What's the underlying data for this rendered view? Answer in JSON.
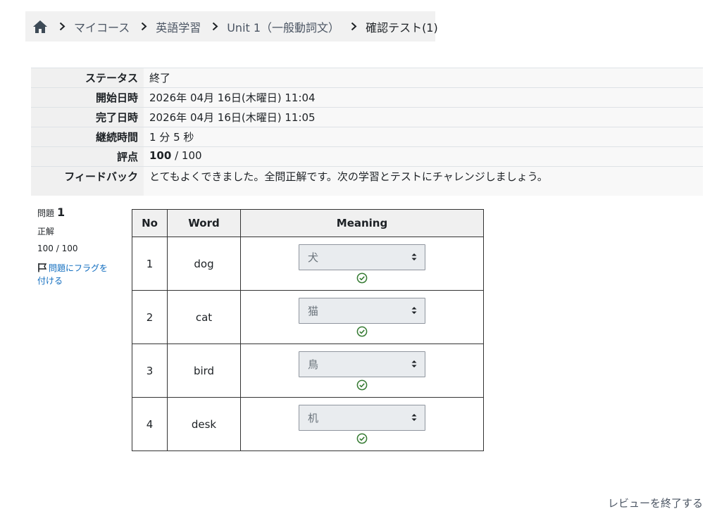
{
  "breadcrumb": {
    "items": [
      "マイコース",
      "英語学習",
      "Unit 1（一般動詞文）"
    ],
    "current": "確認テスト(1)"
  },
  "summary": {
    "status_label": "ステータス",
    "status_value": "終了",
    "started_label": "開始日時",
    "started_value": "2026年 04月 16日(木曜日) 11:04",
    "completed_label": "完了日時",
    "completed_value": "2026年 04月 16日(木曜日) 11:05",
    "duration_label": "継続時間",
    "duration_value": "1 分 5 秒",
    "grade_label": "評点",
    "grade_score": "100",
    "grade_max": " / 100",
    "feedback_label": "フィードバック",
    "feedback_value": "とてもよくできました。全問正解です。次の学習とテストにチャレンジしましょう。"
  },
  "question": {
    "label": "問題",
    "number": "1",
    "state": "正解",
    "grade": "100 / 100",
    "flag_label": "問題にフラグを付ける"
  },
  "word_table": {
    "headers": {
      "no": "No",
      "word": "Word",
      "meaning": "Meaning"
    },
    "rows": [
      {
        "no": "1",
        "word": "dog",
        "meaning": "犬"
      },
      {
        "no": "2",
        "word": "cat",
        "meaning": "猫"
      },
      {
        "no": "3",
        "word": "bird",
        "meaning": "鳥"
      },
      {
        "no": "4",
        "word": "desk",
        "meaning": "机"
      }
    ]
  },
  "footer": {
    "finish_review": "レビューを終了する"
  },
  "colors": {
    "check_green": "#357a32",
    "link_blue": "#0f6cbf",
    "home_icon": "#3d4a56"
  }
}
